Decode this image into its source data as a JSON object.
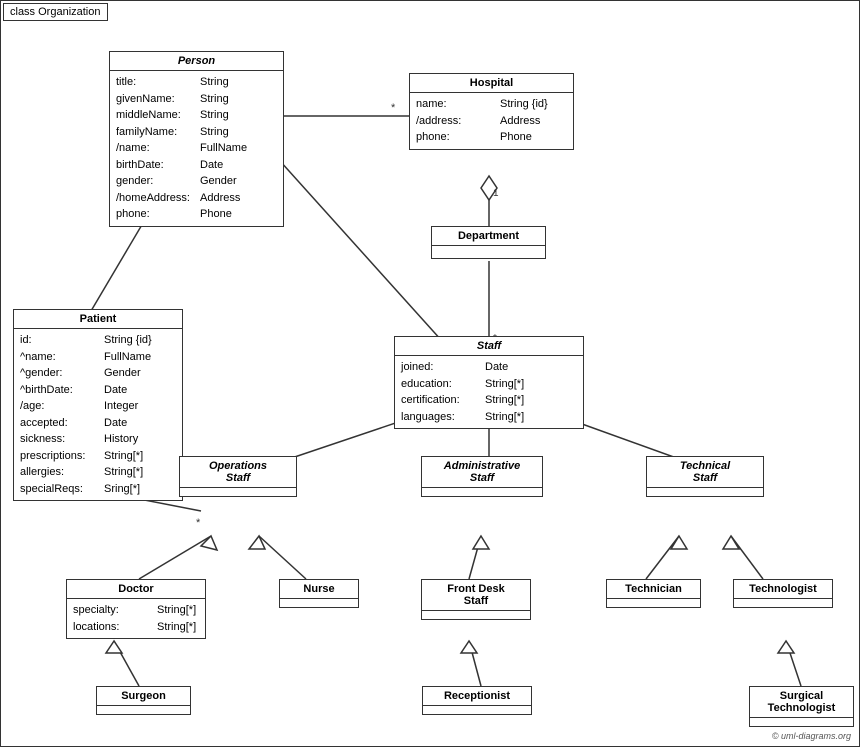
{
  "diagram": {
    "title": "class Organization",
    "copyright": "© uml-diagrams.org",
    "classes": {
      "person": {
        "title": "Person",
        "italic": true,
        "attrs": [
          {
            "name": "title:",
            "type": "String"
          },
          {
            "name": "givenName:",
            "type": "String"
          },
          {
            "name": "middleName:",
            "type": "String"
          },
          {
            "name": "familyName:",
            "type": "String"
          },
          {
            "name": "/name:",
            "type": "FullName"
          },
          {
            "name": "birthDate:",
            "type": "Date"
          },
          {
            "name": "gender:",
            "type": "Gender"
          },
          {
            "name": "/homeAddress:",
            "type": "Address"
          },
          {
            "name": "phone:",
            "type": "Phone"
          }
        ]
      },
      "hospital": {
        "title": "Hospital",
        "attrs": [
          {
            "name": "name:",
            "type": "String {id}"
          },
          {
            "name": "/address:",
            "type": "Address"
          },
          {
            "name": "phone:",
            "type": "Phone"
          }
        ]
      },
      "patient": {
        "title": "Patient",
        "attrs": [
          {
            "name": "id:",
            "type": "String {id}"
          },
          {
            "name": "^name:",
            "type": "FullName"
          },
          {
            "name": "^gender:",
            "type": "Gender"
          },
          {
            "name": "^birthDate:",
            "type": "Date"
          },
          {
            "name": "/age:",
            "type": "Integer"
          },
          {
            "name": "accepted:",
            "type": "Date"
          },
          {
            "name": "sickness:",
            "type": "History"
          },
          {
            "name": "prescriptions:",
            "type": "String[*]"
          },
          {
            "name": "allergies:",
            "type": "String[*]"
          },
          {
            "name": "specialReqs:",
            "type": "Sring[*]"
          }
        ]
      },
      "department": {
        "title": "Department",
        "attrs": []
      },
      "staff": {
        "title": "Staff",
        "italic": false,
        "attrs": [
          {
            "name": "joined:",
            "type": "Date"
          },
          {
            "name": "education:",
            "type": "String[*]"
          },
          {
            "name": "certification:",
            "type": "String[*]"
          },
          {
            "name": "languages:",
            "type": "String[*]"
          }
        ]
      },
      "operations_staff": {
        "title": "Operations Staff",
        "italic": true,
        "attrs": []
      },
      "administrative_staff": {
        "title": "Administrative Staff",
        "italic": true,
        "attrs": []
      },
      "technical_staff": {
        "title": "Technical Staff",
        "italic": true,
        "attrs": []
      },
      "doctor": {
        "title": "Doctor",
        "attrs": [
          {
            "name": "specialty:",
            "type": "String[*]"
          },
          {
            "name": "locations:",
            "type": "String[*]"
          }
        ]
      },
      "nurse": {
        "title": "Nurse",
        "attrs": []
      },
      "front_desk_staff": {
        "title": "Front Desk Staff",
        "attrs": []
      },
      "technician": {
        "title": "Technician",
        "attrs": []
      },
      "technologist": {
        "title": "Technologist",
        "attrs": []
      },
      "surgeon": {
        "title": "Surgeon",
        "attrs": []
      },
      "receptionist": {
        "title": "Receptionist",
        "attrs": []
      },
      "surgical_technologist": {
        "title": "Surgical Technologist",
        "attrs": []
      }
    }
  }
}
